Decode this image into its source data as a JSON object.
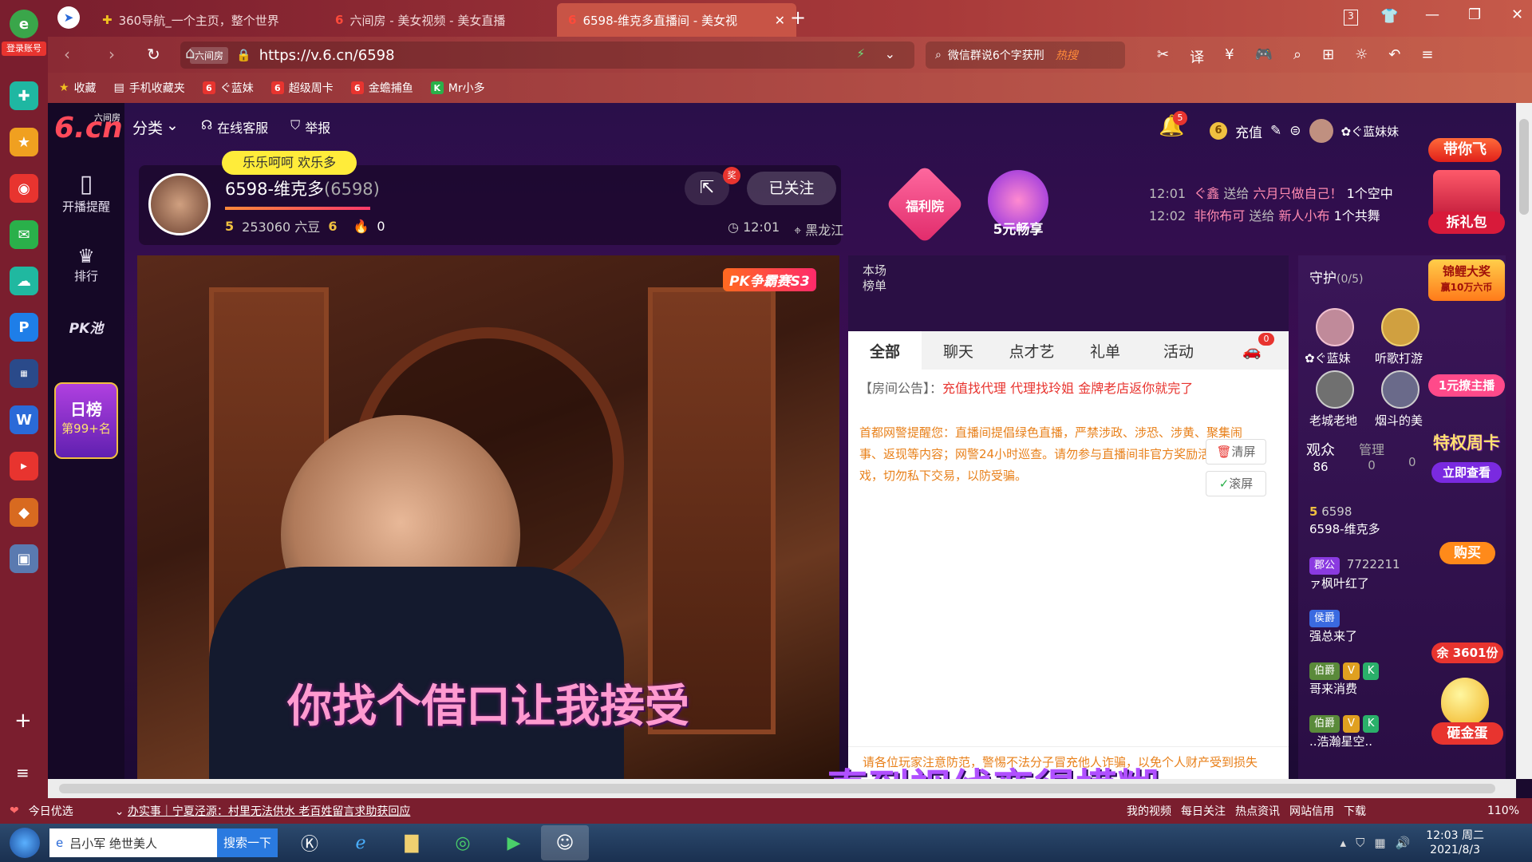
{
  "browser": {
    "sidebar_login": "登录账号",
    "tabs": [
      {
        "label": "360导航_一个主页，整个世界"
      },
      {
        "label": "六间房 - 美女视频 - 美女直播"
      },
      {
        "label": "6598-维克多直播间 - 美女视"
      }
    ],
    "tab_count": "3",
    "url": "https://v.6.cn/6598",
    "url_prefix": "六间房",
    "search_text": "微信群说6个字获刑",
    "search_hot": "热搜",
    "bookmarks": [
      "收藏",
      "手机收藏夹",
      "ぐ蓝妹",
      "超级周卡",
      "金蟾捕鱼",
      "Mr小多"
    ],
    "zoom": "110%"
  },
  "site": {
    "logo_main": "6.cn",
    "logo_sub": "六间房",
    "nav": [
      "分类",
      "在线客服",
      "举报"
    ],
    "notif_count": "5",
    "recharge": "充值",
    "user_name": "✿ぐ蓝妹妹",
    "promo_fly": "带你飞",
    "left_nav": [
      "开播提醒",
      "排行",
      "PK池"
    ],
    "day_rank_title": "日榜",
    "day_rank_value": "第99+名"
  },
  "streamer": {
    "bubble": "乐乐呵呵 欢乐多",
    "name": "6598-维克多",
    "id": "(6598)",
    "level_left": "5",
    "beans": "253060 六豆",
    "level_right": "6",
    "fire": "0",
    "follow_label": "已关注",
    "share_badge": "奖",
    "time": "12:01",
    "location": "黑龙江"
  },
  "promos": {
    "welfare": "福利院",
    "five_yuan": "5元畅享",
    "gift_pack": "拆礼包",
    "koi": "锦鲤大奖",
    "koi_sub": "赢10万六币",
    "one_yuan": "1元撩主播",
    "weekly": "特权周卡",
    "weekly_btn": "立即查看",
    "buy": "购买",
    "left_count": "余 3601份",
    "egg": "砸金蛋"
  },
  "ticker": [
    {
      "time": "12:01",
      "from": "ぐ鑫",
      "verb": "送给",
      "to": "六月只做自己！",
      "gift": "1个空中"
    },
    {
      "time": "12:02",
      "from": "非你布可",
      "verb": "送给",
      "to": "新人小布",
      "gift": "1个共舞"
    }
  ],
  "video": {
    "pk_badge": "PK争霸赛S3",
    "subtitle": "你找个借口让我接受",
    "overlay_caption": "直到视线变得模糊"
  },
  "chat": {
    "rank_label": "本场榜单",
    "tabs": [
      "全部",
      "聊天",
      "点才艺",
      "礼单",
      "活动"
    ],
    "car_badge": "0",
    "notice_prefix": "【房间公告】：",
    "notice_text": "充值找代理 代理找玲姐 金牌老店返你就完了",
    "warning": "首都网警提醒您：直播间提倡绿色直播，严禁涉政、涉恐、涉黄、聚集闹事、返现等内容；网警24小时巡查。请勿参与直播间非官方奖励活动/游戏，切勿私下交易，以防受骗。",
    "clear_btn": "清屏",
    "scroll_btn": "滚屏",
    "footer_warning": "请各位玩家注意防范，警惕不法分子冒充他人诈骗，以免个人财产受到损失"
  },
  "guard": {
    "title": "守护",
    "count": "(0/5)",
    "members": [
      "✿ぐ蓝妹",
      "听歌打游",
      "老城老地",
      "烟斗的美"
    ],
    "tab_audience": "观众",
    "audience_count": "86",
    "tab_admin": "管理",
    "admin_count": "0",
    "tab_third_count": "0",
    "users": [
      {
        "badge": "5",
        "id": "6598",
        "name": "6598-维克多"
      },
      {
        "badge": "郡公",
        "id": "7722211",
        "name": "ァ枫叶红了"
      },
      {
        "badge": "侯爵",
        "id": "",
        "name": "强总来了"
      },
      {
        "badge": "伯爵",
        "id": "",
        "name": "哥来消费"
      },
      {
        "badge": "伯爵",
        "id": "",
        "name": "..浩瀚星空.."
      }
    ]
  },
  "statusbar": {
    "left_label": "今日优选",
    "news": "办实事｜宁夏泾源：村里无法供水 老百姓留言求助获回应",
    "items": [
      "我的视频",
      "每日关注",
      "热点资讯",
      "网站信用",
      "下载"
    ]
  },
  "taskbar": {
    "search_text": "吕小军 绝世美人",
    "search_btn": "搜索一下",
    "time": "12:03 周二",
    "date": "2021/8/3"
  }
}
